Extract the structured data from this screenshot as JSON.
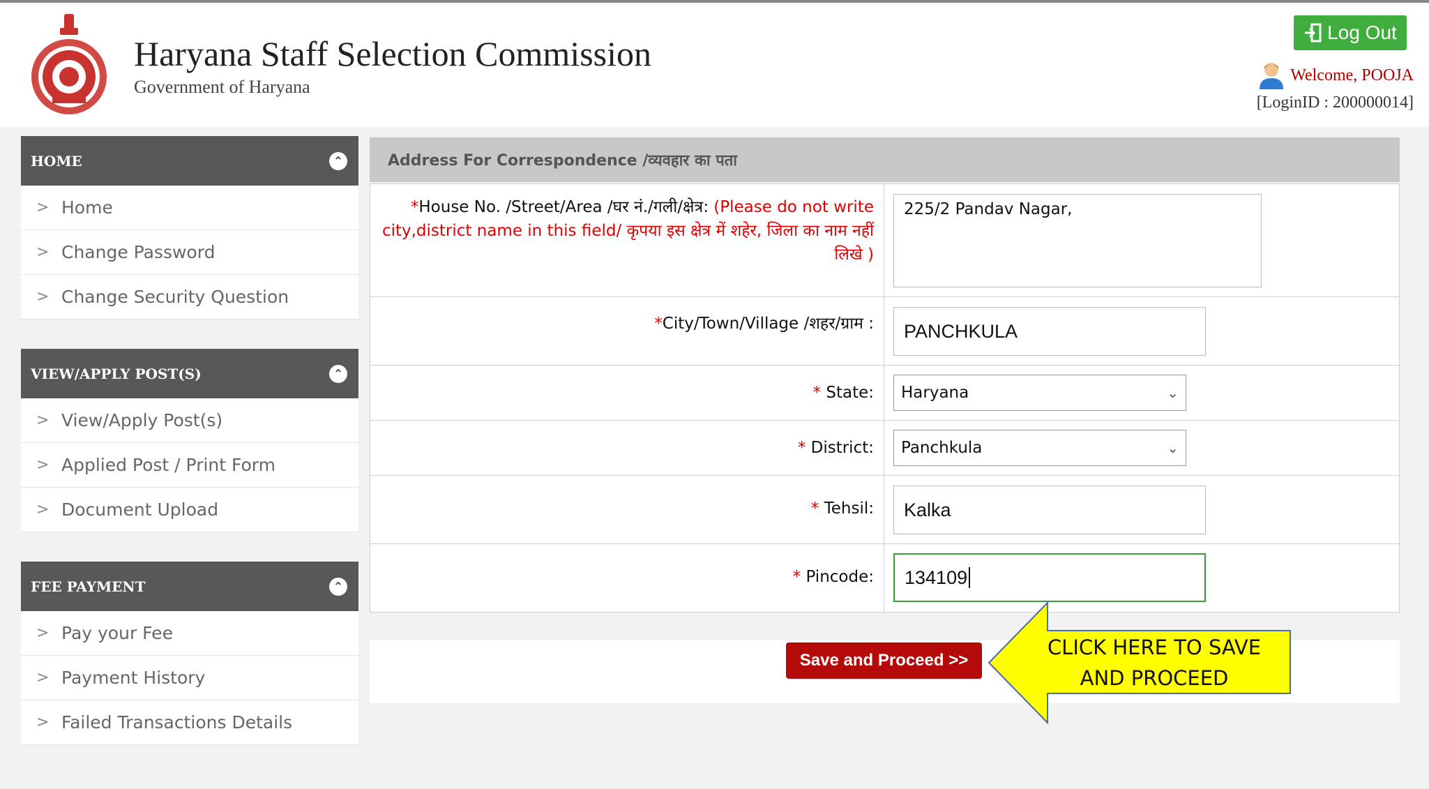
{
  "header": {
    "title": "Haryana Staff Selection Commission",
    "subtitle": "Government of Haryana",
    "logout_label": "Log Out",
    "welcome": "Welcome, POOJA",
    "login_id": "[LoginID : 200000014]"
  },
  "sidebar": {
    "sections": [
      {
        "title": "HOME",
        "items": [
          "Home",
          "Change Password",
          "Change Security Question"
        ]
      },
      {
        "title": "VIEW/APPLY POST(S)",
        "items": [
          "View/Apply Post(s)",
          "Applied Post / Print Form",
          "Document Upload"
        ]
      },
      {
        "title": "FEE PAYMENT",
        "items": [
          "Pay your Fee",
          "Payment History",
          "Failed Transactions Details"
        ]
      }
    ]
  },
  "form": {
    "heading": "Address For Correspondence /व्यवहार का पता",
    "house": {
      "label": "House No. /Street/Area /घर नं./गली/क्षेत्र:",
      "note": "(Please do not write city,district name in this field/ कृपया इस क्षेत्र में शहेर, जिला का नाम नहीं लिखे )",
      "value": "225/2 Pandav Nagar,"
    },
    "city": {
      "label": "City/Town/Village /शहर/ग्राम :",
      "value": "PANCHKULA"
    },
    "state": {
      "label": "State:",
      "value": "Haryana"
    },
    "district": {
      "label": "District:",
      "value": "Panchkula"
    },
    "tehsil": {
      "label": "Tehsil:",
      "value": "Kalka"
    },
    "pincode": {
      "label": "Pincode:",
      "value": "134109"
    },
    "required_mark": "*"
  },
  "actions": {
    "save_label": "Save and Proceed >>",
    "callout": "CLICK HERE TO SAVE AND PROCEED"
  },
  "colors": {
    "header_bar": "#575757",
    "save_button": "#b40a0a",
    "logout_button": "#3fae3f",
    "callout_fill": "#ffff00"
  }
}
